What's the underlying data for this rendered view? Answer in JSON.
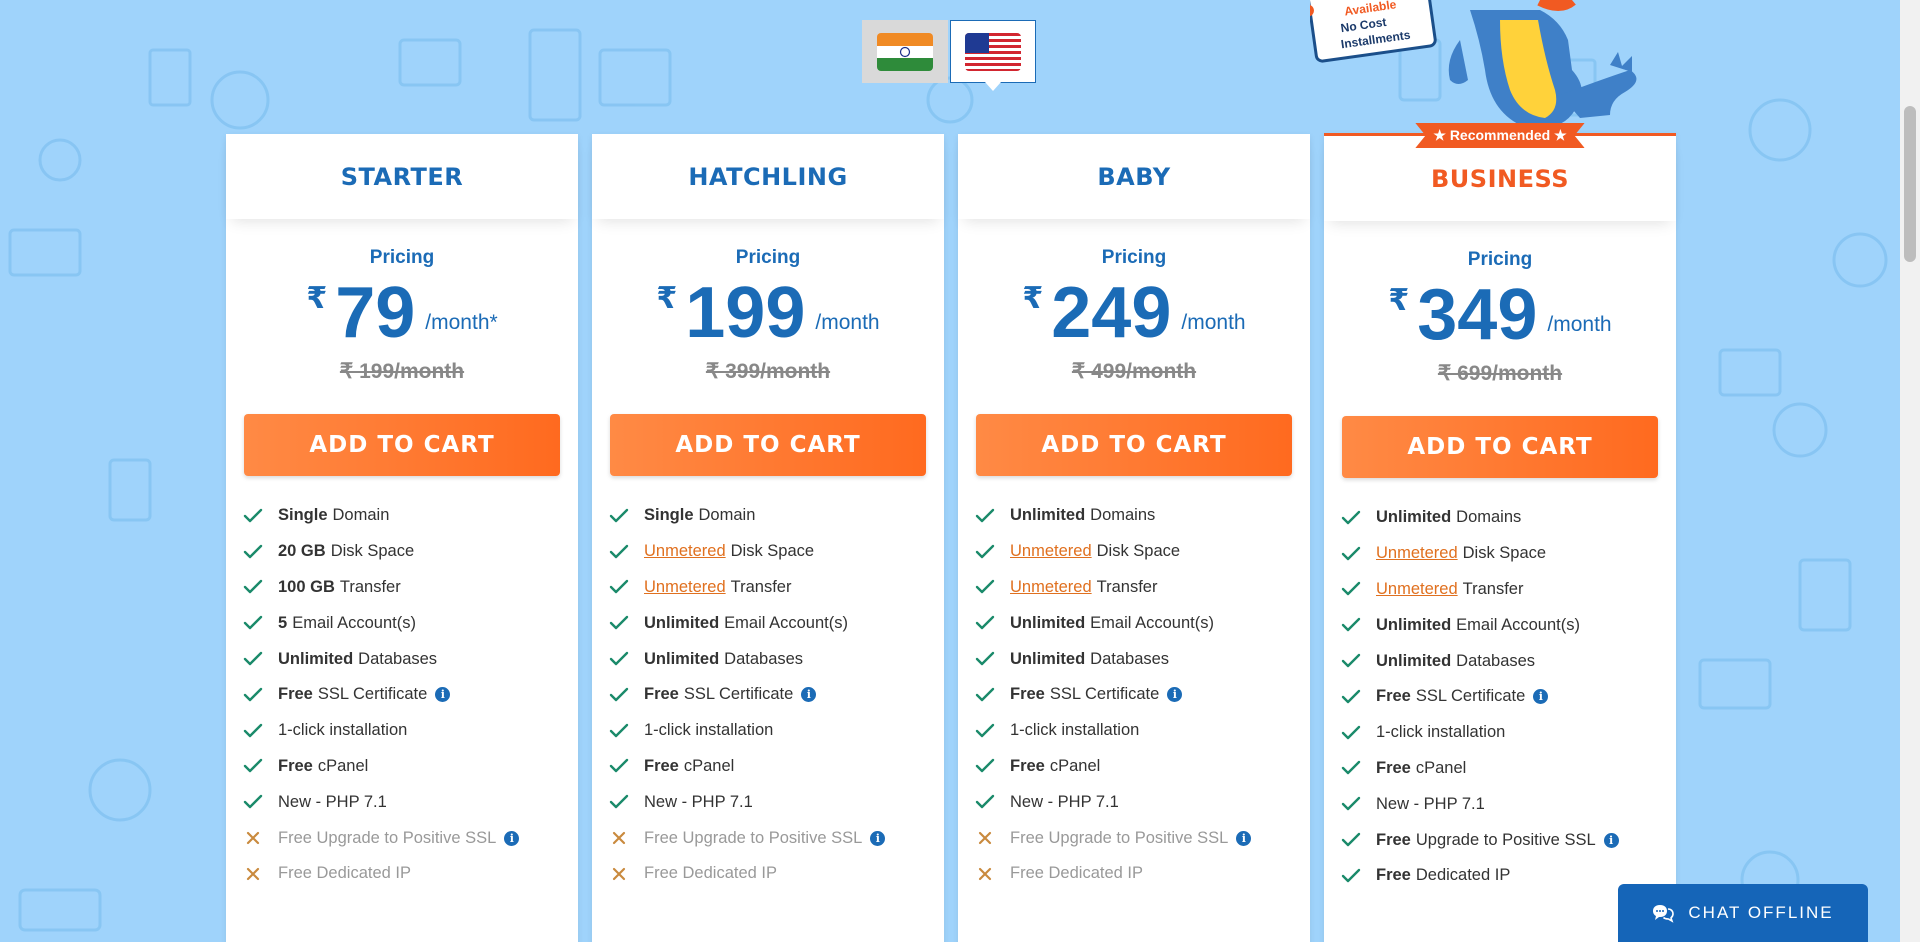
{
  "country_selector": {
    "options": [
      {
        "name": "India",
        "active": false
      },
      {
        "name": "USA",
        "active": true
      }
    ]
  },
  "promo_sign": {
    "line1": "Available",
    "line2": "No Cost",
    "line3": "Installments"
  },
  "plans": [
    {
      "name": "STARTER",
      "recommended": false,
      "pricing_label": "Pricing",
      "currency": "₹",
      "price": "79",
      "period": "/month*",
      "old_price": "₹ 199/month",
      "cta": "ADD TO CART",
      "features": [
        {
          "bold": "Single",
          "text": "Domain",
          "state": "check"
        },
        {
          "bold": "20 GB",
          "text": "Disk Space",
          "state": "check"
        },
        {
          "bold": "100 GB",
          "text": "Transfer",
          "state": "check"
        },
        {
          "bold": "5",
          "text": "Email Account(s)",
          "state": "check"
        },
        {
          "bold": "Unlimited",
          "text": "Databases",
          "state": "check"
        },
        {
          "bold": "Free",
          "text": "SSL Certificate",
          "state": "check",
          "info": true
        },
        {
          "bold": "",
          "text": "1-click installation",
          "state": "check"
        },
        {
          "bold": "Free",
          "text": "cPanel",
          "state": "check"
        },
        {
          "bold": "",
          "text": "New - PHP 7.1",
          "state": "check"
        },
        {
          "bold": "",
          "text": "Free Upgrade to Positive SSL",
          "state": "cross",
          "info": true
        },
        {
          "bold": "",
          "text": "Free Dedicated IP",
          "state": "cross"
        }
      ]
    },
    {
      "name": "HATCHLING",
      "recommended": false,
      "pricing_label": "Pricing",
      "currency": "₹",
      "price": "199",
      "period": "/month",
      "old_price": "₹ 399/month",
      "cta": "ADD TO CART",
      "features": [
        {
          "bold": "Single",
          "text": "Domain",
          "state": "check"
        },
        {
          "highlight": "Unmetered",
          "text": "Disk Space",
          "state": "check"
        },
        {
          "highlight": "Unmetered",
          "text": "Transfer",
          "state": "check"
        },
        {
          "bold": "Unlimited",
          "text": "Email Account(s)",
          "state": "check"
        },
        {
          "bold": "Unlimited",
          "text": "Databases",
          "state": "check"
        },
        {
          "bold": "Free",
          "text": "SSL Certificate",
          "state": "check",
          "info": true
        },
        {
          "bold": "",
          "text": "1-click installation",
          "state": "check"
        },
        {
          "bold": "Free",
          "text": "cPanel",
          "state": "check"
        },
        {
          "bold": "",
          "text": "New - PHP 7.1",
          "state": "check"
        },
        {
          "bold": "",
          "text": "Free Upgrade to Positive SSL",
          "state": "cross",
          "info": true
        },
        {
          "bold": "",
          "text": "Free Dedicated IP",
          "state": "cross"
        }
      ]
    },
    {
      "name": "BABY",
      "recommended": false,
      "pricing_label": "Pricing",
      "currency": "₹",
      "price": "249",
      "period": "/month",
      "old_price": "₹ 499/month",
      "cta": "ADD TO CART",
      "features": [
        {
          "bold": "Unlimited",
          "text": "Domains",
          "state": "check"
        },
        {
          "highlight": "Unmetered",
          "text": "Disk Space",
          "state": "check"
        },
        {
          "highlight": "Unmetered",
          "text": "Transfer",
          "state": "check"
        },
        {
          "bold": "Unlimited",
          "text": "Email Account(s)",
          "state": "check"
        },
        {
          "bold": "Unlimited",
          "text": "Databases",
          "state": "check"
        },
        {
          "bold": "Free",
          "text": "SSL Certificate",
          "state": "check",
          "info": true
        },
        {
          "bold": "",
          "text": "1-click installation",
          "state": "check"
        },
        {
          "bold": "Free",
          "text": "cPanel",
          "state": "check"
        },
        {
          "bold": "",
          "text": "New - PHP 7.1",
          "state": "check"
        },
        {
          "bold": "",
          "text": "Free Upgrade to Positive SSL",
          "state": "cross",
          "info": true
        },
        {
          "bold": "",
          "text": "Free Dedicated IP",
          "state": "cross"
        }
      ]
    },
    {
      "name": "BUSINESS",
      "recommended": true,
      "badge": "★ Recommended ★",
      "pricing_label": "Pricing",
      "currency": "₹",
      "price": "349",
      "period": "/month",
      "old_price": "₹ 699/month",
      "cta": "ADD TO CART",
      "features": [
        {
          "bold": "Unlimited",
          "text": "Domains",
          "state": "check"
        },
        {
          "highlight": "Unmetered",
          "text": "Disk Space",
          "state": "check"
        },
        {
          "highlight": "Unmetered",
          "text": "Transfer",
          "state": "check"
        },
        {
          "bold": "Unlimited",
          "text": "Email Account(s)",
          "state": "check"
        },
        {
          "bold": "Unlimited",
          "text": "Databases",
          "state": "check"
        },
        {
          "bold": "Free",
          "text": "SSL Certificate",
          "state": "check",
          "info": true
        },
        {
          "bold": "",
          "text": "1-click installation",
          "state": "check"
        },
        {
          "bold": "Free",
          "text": "cPanel",
          "state": "check"
        },
        {
          "bold": "",
          "text": "New - PHP 7.1",
          "state": "check"
        },
        {
          "bold": "Free",
          "text": "Upgrade to Positive SSL",
          "state": "check",
          "info": true
        },
        {
          "bold": "Free",
          "text": "Dedicated IP",
          "state": "check"
        }
      ]
    }
  ],
  "chat": {
    "label": "CHAT OFFLINE",
    "icon": "chat-bubble-icon"
  },
  "colors": {
    "accent_blue": "#1b6bb6",
    "accent_orange": "#f15a22",
    "check_green": "#1a8a6a",
    "cross_orange": "#c98a3e",
    "background": "#9fd3fb"
  }
}
